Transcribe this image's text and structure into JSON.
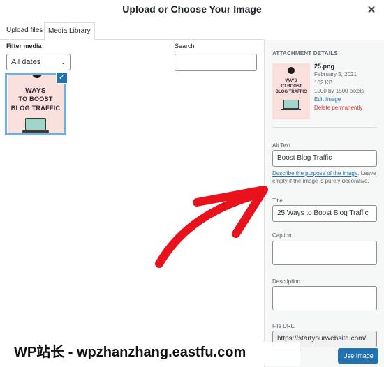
{
  "modal": {
    "title": "Upload or Choose Your Image",
    "close_icon": "close-icon"
  },
  "tabs": [
    {
      "label": "Upload files",
      "active": false
    },
    {
      "label": "Media Library",
      "active": true
    }
  ],
  "filter": {
    "label": "Filter media",
    "selected": "All dates"
  },
  "search": {
    "label": "Search",
    "value": ""
  },
  "grid": {
    "items": [
      {
        "lines": [
          "WAYS",
          "TO BOOST",
          "BLOG TRAFFIC"
        ],
        "selected": true
      }
    ]
  },
  "attachment": {
    "header": "ATTACHMENT DETAILS",
    "thumb_lines": [
      "25",
      "WAYS",
      "TO BOOST",
      "BLOG TRAFFIC"
    ],
    "filename": "25.png",
    "date": "February 5, 2021",
    "size": "102 KB",
    "dimensions": "1000 by 1500 pixels",
    "edit_link": "Edit Image",
    "delete_link": "Delete permanently"
  },
  "fields": {
    "alt_label": "Alt Text",
    "alt_value": "Boost Blog Traffic",
    "alt_hint_link": "Describe the purpose of the image",
    "alt_hint_rest": ". Leave empty if the image is purely decorative.",
    "title_label": "Title",
    "title_value": "25 Ways to Boost Blog Traffic",
    "caption_label": "Caption",
    "description_label": "Description",
    "fileurl_label": "File URL:",
    "fileurl_value": "https://startyourwebsite.com/"
  },
  "watermark": "WP站长 - wpzhanzhang.eastfu.com",
  "footer": {
    "use_button": "Use Image"
  },
  "colors": {
    "primary": "#2271b1",
    "selection": "#72aee6",
    "delete": "#d63638",
    "arrow": "#e8121d"
  }
}
